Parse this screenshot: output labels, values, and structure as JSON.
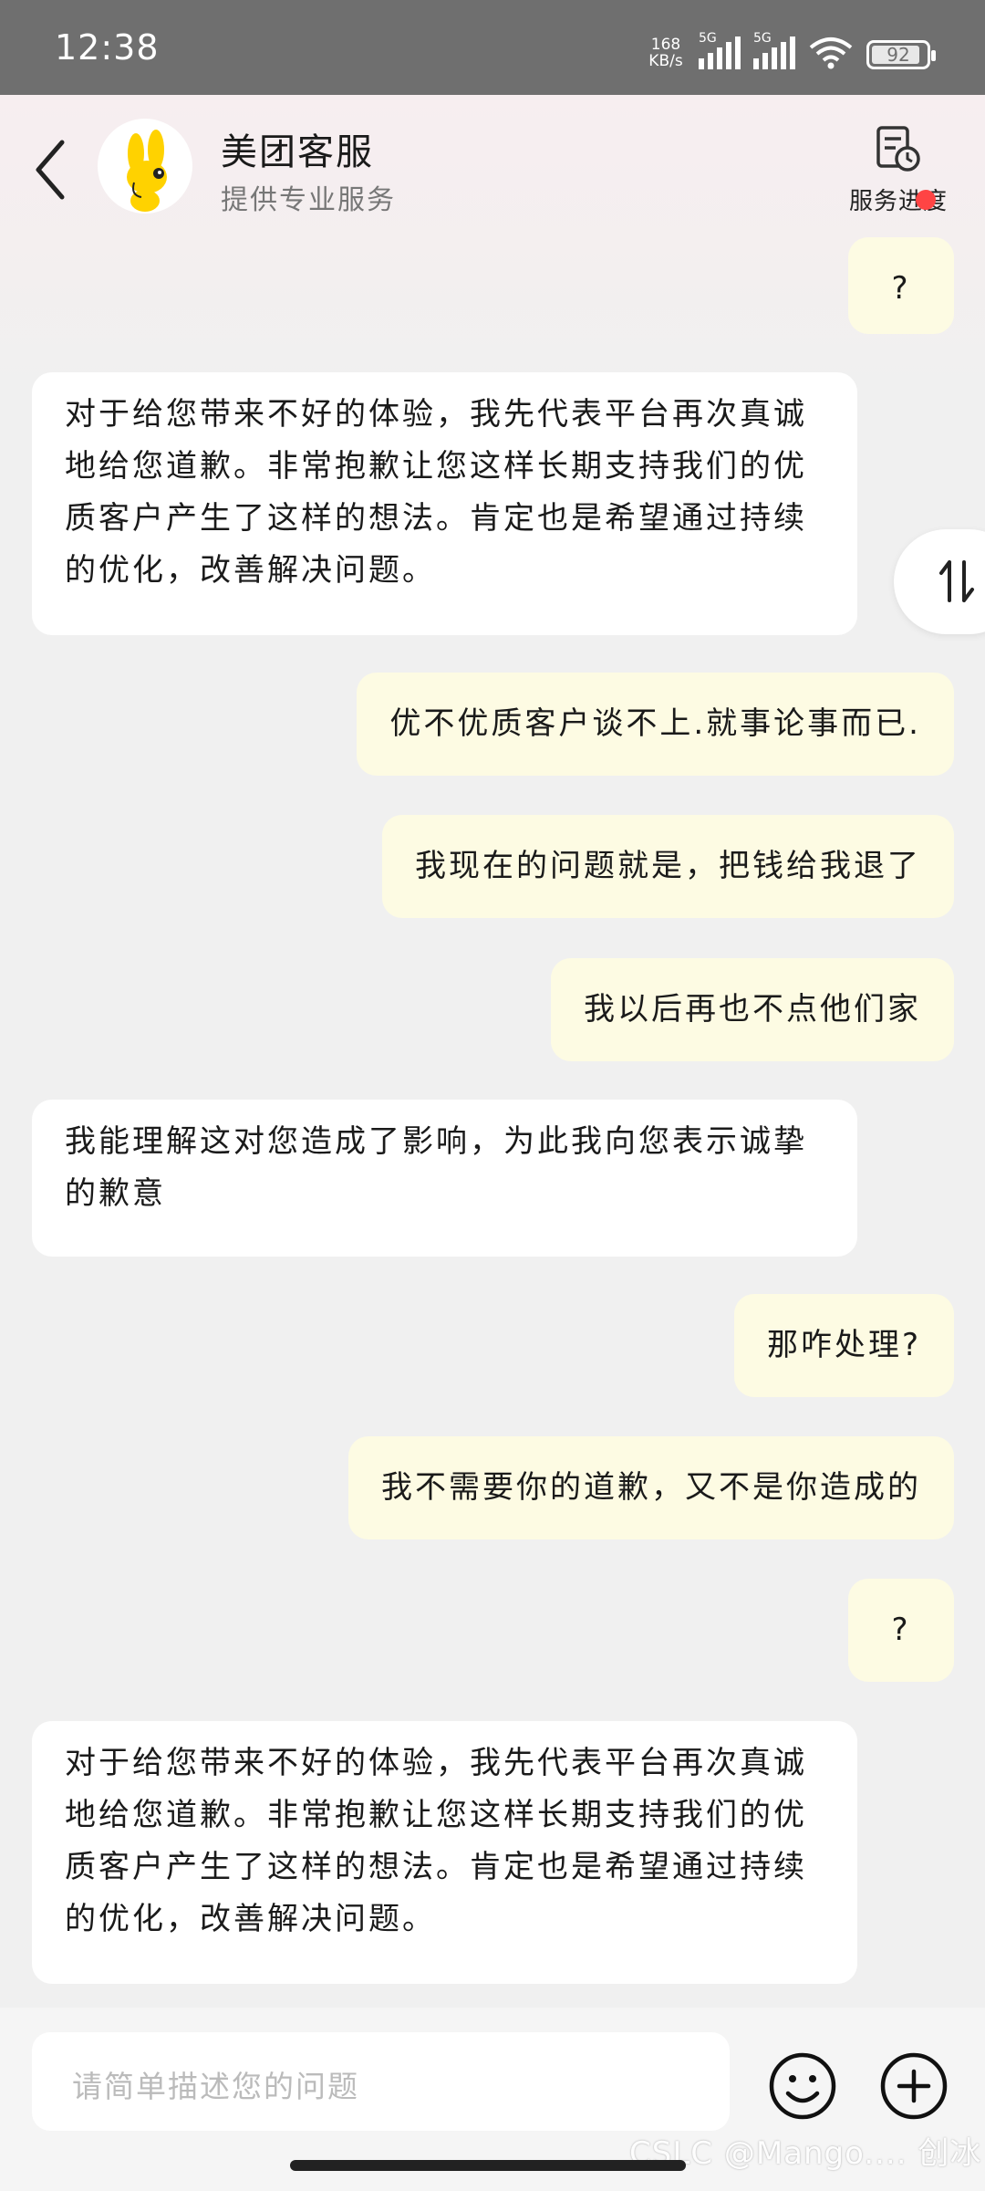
{
  "status": {
    "time": "12:38",
    "net_speed": "168 KB/s",
    "sig1": "5G",
    "sig2": "5G",
    "battery": "92"
  },
  "header": {
    "title": "美团客服",
    "subtitle": "提供专业服务",
    "progress_label": "服务进度"
  },
  "messages": [
    {
      "from": "user",
      "text": "?"
    },
    {
      "from": "agent",
      "text": "对于给您带来不好的体验，我先代表平台再次真诚地给您道歉。非常抱歉让您这样长期支持我们的优质客户产生了这样的想法。肯定也是希望通过持续的优化，改善解决问题。"
    },
    {
      "from": "user",
      "text": "优不优质客户谈不上.就事论事而已."
    },
    {
      "from": "user",
      "text": "我现在的问题就是，把钱给我退了"
    },
    {
      "from": "user",
      "text": "我以后再也不点他们家"
    },
    {
      "from": "agent",
      "text": "我能理解这对您造成了影响，为此我向您表示诚挚的歉意"
    },
    {
      "from": "user",
      "text": "那咋处理?"
    },
    {
      "from": "user",
      "text": "我不需要你的道歉，又不是你造成的"
    },
    {
      "from": "user",
      "text": "?"
    },
    {
      "from": "agent",
      "text": "对于给您带来不好的体验，我先代表平台再次真诚地给您道歉。非常抱歉让您这样长期支持我们的优质客户产生了这样的想法。肯定也是希望通过持续的优化，改善解决问题。"
    }
  ],
  "input": {
    "placeholder": "请简单描述您的问题"
  },
  "watermark": "CSLC @Mango.... 创冰",
  "colors": {
    "user_bubble": "#fdfbe3",
    "agent_bubble": "#ffffff",
    "background": "#f0f0f0",
    "badge": "#ff4444"
  }
}
